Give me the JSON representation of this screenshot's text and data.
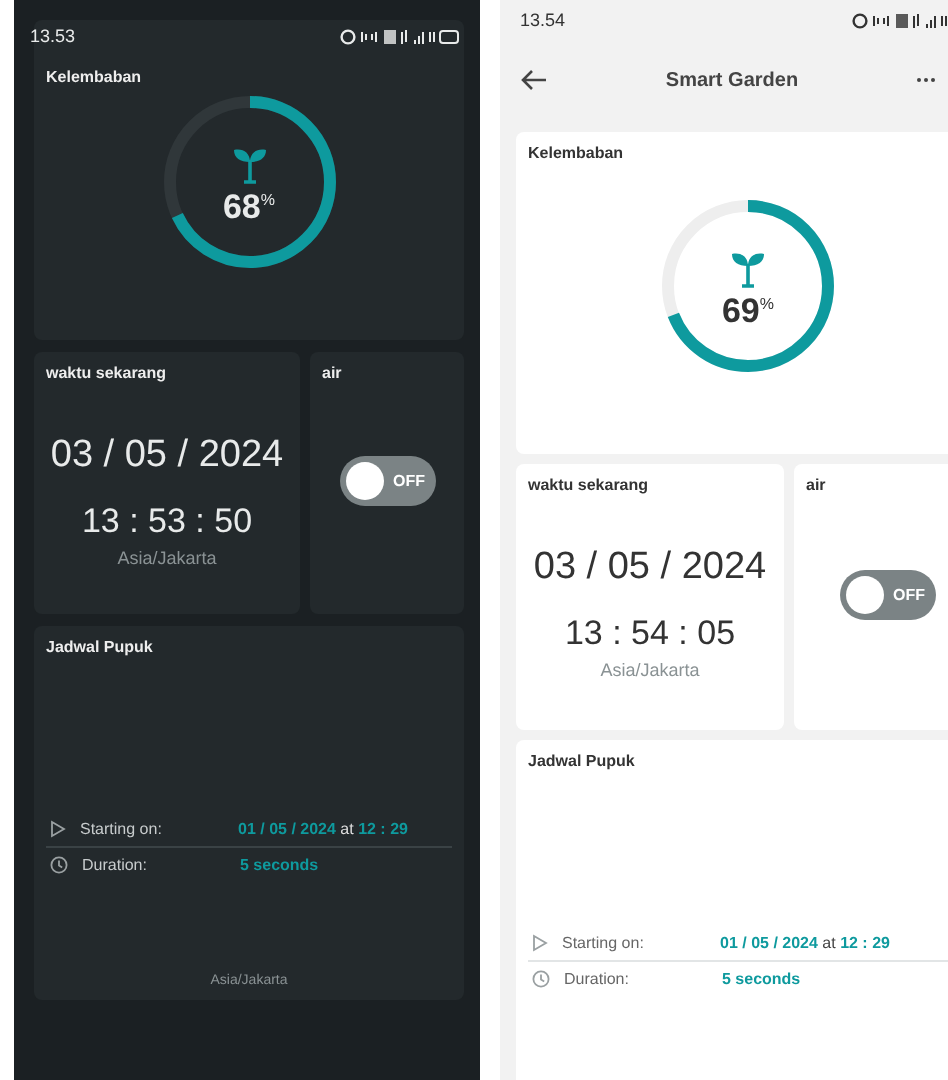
{
  "screens": [
    {
      "kind": "dark",
      "status_bar": {
        "time": "13.53"
      },
      "humidity": {
        "label": "Kelembaban",
        "value": "68",
        "unit": "%",
        "level": 0.68
      },
      "clock": {
        "label": "waktu sekarang",
        "date": "03 / 05 / 2024",
        "time": "13 : 53 : 50",
        "timezone": "Asia/Jakarta"
      },
      "pump": {
        "label": "air",
        "switch": {
          "on": false,
          "text": "OFF"
        }
      },
      "schedule": {
        "label": "Jadwal Pupuk",
        "rows": [
          {
            "kind": "start",
            "label": "Starting on:",
            "date": "01 / 05 / 2024",
            "connector": "at",
            "time": "12 : 29"
          },
          {
            "kind": "duration",
            "label": "Duration:",
            "value": "5 seconds"
          }
        ],
        "footer": "Asia/Jakarta"
      }
    },
    {
      "kind": "light",
      "status_bar": {
        "time": "13.54"
      },
      "header": {
        "title": "Smart Garden"
      },
      "humidity": {
        "label": "Kelembaban",
        "value": "69",
        "unit": "%",
        "level": 0.69
      },
      "clock": {
        "label": "waktu sekarang",
        "date": "03 / 05 / 2024",
        "time": "13 : 54 : 05",
        "timezone": "Asia/Jakarta"
      },
      "pump": {
        "label": "air",
        "switch": {
          "on": false,
          "text": "OFF"
        }
      },
      "schedule": {
        "label": "Jadwal Pupuk",
        "rows": [
          {
            "kind": "start",
            "label": "Starting on:",
            "date": "01 / 05 / 2024",
            "connector": "at",
            "time": "12 : 29"
          },
          {
            "kind": "duration",
            "label": "Duration:",
            "value": "5 seconds"
          }
        ]
      }
    }
  ]
}
